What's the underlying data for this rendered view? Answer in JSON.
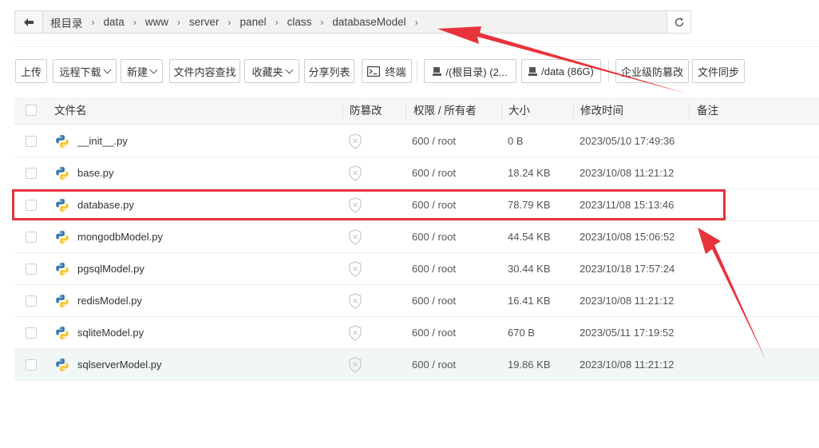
{
  "breadcrumb": {
    "items": [
      "根目录",
      "data",
      "www",
      "server",
      "panel",
      "class",
      "databaseModel"
    ]
  },
  "toolbar": {
    "upload": "上传",
    "remote_download": "远程下载",
    "new": "新建",
    "content_search": "文件内容查找",
    "favorites": "收藏夹",
    "share_list": "分享列表",
    "terminal": "终端",
    "disk_root": "/(根目录) (2...",
    "disk_data": "/data (86G)",
    "tamper_proof": "企业级防篡改",
    "file_sync": "文件同步"
  },
  "table": {
    "headers": {
      "name": "文件名",
      "tamper": "防篡改",
      "perm": "权限 / 所有者",
      "size": "大小",
      "mtime": "修改时间",
      "remark": "备注"
    },
    "rows": [
      {
        "name": "__init__.py",
        "perm": "600 / root",
        "size": "0 B",
        "mtime": "2023/05/10 17:49:36"
      },
      {
        "name": "base.py",
        "perm": "600 / root",
        "size": "18.24 KB",
        "mtime": "2023/10/08 11:21:12"
      },
      {
        "name": "database.py",
        "perm": "600 / root",
        "size": "78.79 KB",
        "mtime": "2023/11/08 15:13:46"
      },
      {
        "name": "mongodbModel.py",
        "perm": "600 / root",
        "size": "44.54 KB",
        "mtime": "2023/10/08 15:06:52"
      },
      {
        "name": "pgsqlModel.py",
        "perm": "600 / root",
        "size": "30.44 KB",
        "mtime": "2023/10/18 17:57:24"
      },
      {
        "name": "redisModel.py",
        "perm": "600 / root",
        "size": "16.41 KB",
        "mtime": "2023/10/08 11:21:12"
      },
      {
        "name": "sqliteModel.py",
        "perm": "600 / root",
        "size": "670 B",
        "mtime": "2023/05/11 17:19:52"
      },
      {
        "name": "sqlserverModel.py",
        "perm": "600 / root",
        "size": "19.86 KB",
        "mtime": "2023/10/08 11:21:12"
      }
    ]
  },
  "colors": {
    "annotation_red": "#e8333c",
    "hover_row": "#f1f7f6",
    "python_blue": "#3c78aa",
    "python_yellow": "#f7c93e"
  }
}
